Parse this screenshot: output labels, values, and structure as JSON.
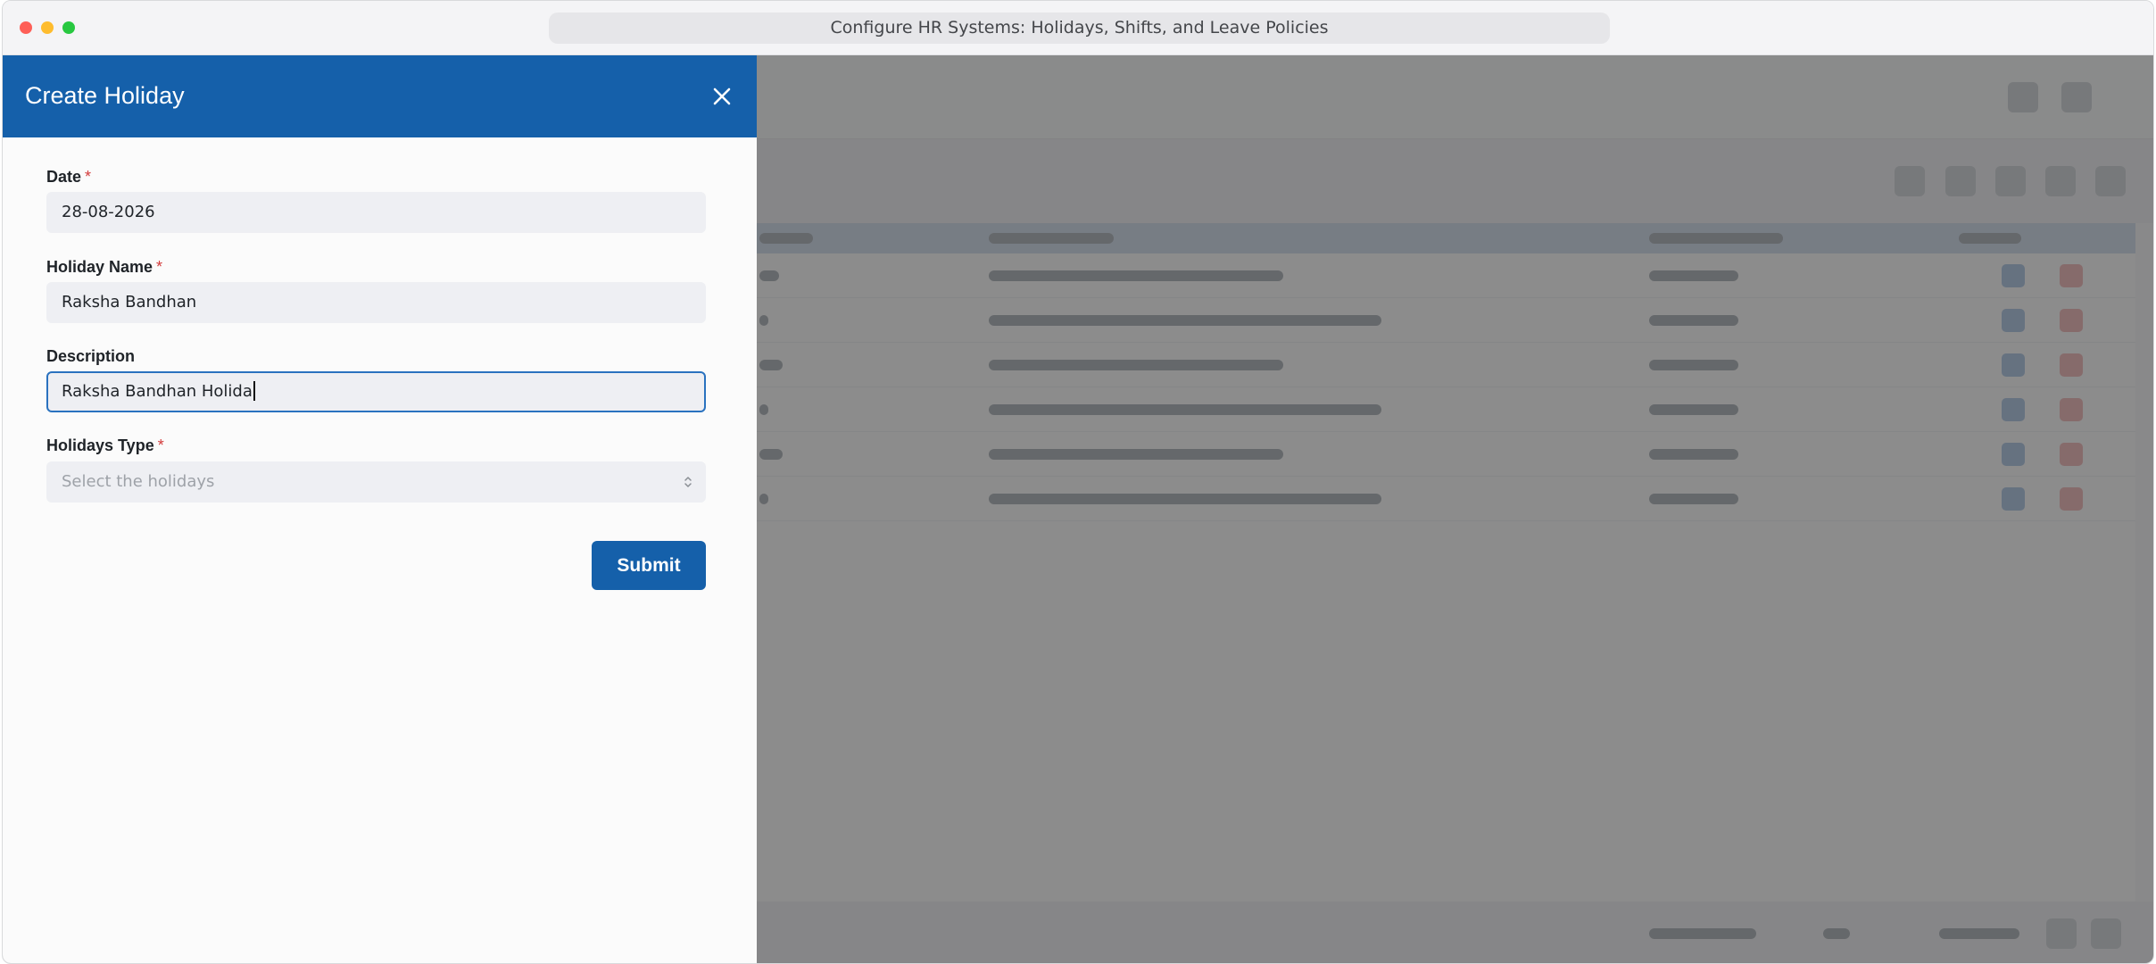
{
  "window": {
    "url_title": "Configure HR Systems: Holidays, Shifts, and Leave Policies"
  },
  "drawer": {
    "title": "Create Holiday",
    "fields": {
      "date": {
        "label": "Date",
        "required_mark": "*",
        "value": "28-08-2026"
      },
      "holiday_name": {
        "label": "Holiday Name",
        "required_mark": "*",
        "value": "Raksha Bandhan"
      },
      "description": {
        "label": "Description",
        "value": "Raksha Bandhan Holida"
      },
      "holidays_type": {
        "label": "Holidays Type",
        "required_mark": "*",
        "placeholder": "Select the holidays"
      }
    },
    "submit_label": "Submit"
  },
  "colors": {
    "primary": "#1560aa",
    "required": "#d33b3b",
    "focus_border": "#2a72bf"
  },
  "icons": {
    "close": "close-icon",
    "select": "chevron-up-down-icon"
  }
}
